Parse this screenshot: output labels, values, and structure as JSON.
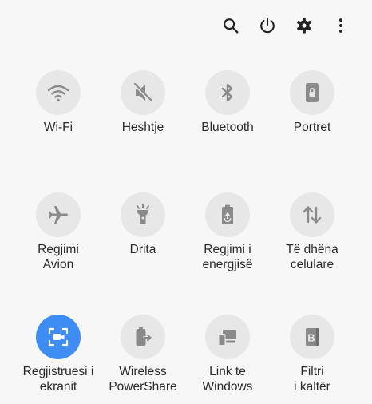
{
  "toolbar": {
    "icons": [
      "search-icon",
      "power-icon",
      "settings-gear-icon",
      "more-options-icon"
    ]
  },
  "tiles": [
    {
      "id": "wifi",
      "label": "Wi-Fi",
      "icon": "wifi-icon",
      "active": false
    },
    {
      "id": "mute",
      "label": "Heshtje",
      "icon": "mute-icon",
      "active": false
    },
    {
      "id": "bluetooth",
      "label": "Bluetooth",
      "icon": "bluetooth-icon",
      "active": false
    },
    {
      "id": "portrait",
      "label": "Portret",
      "icon": "portrait-lock-icon",
      "active": false
    },
    {
      "id": "airplane",
      "label": "Regjimi\nAvion",
      "icon": "airplane-icon",
      "active": false
    },
    {
      "id": "flashlight",
      "label": "Drita",
      "icon": "flashlight-icon",
      "active": false
    },
    {
      "id": "power-saving",
      "label": "Regjimi i\nenergjisë",
      "icon": "battery-saver-icon",
      "active": false
    },
    {
      "id": "mobile-data",
      "label": "Të dhëna\ncelulare",
      "icon": "mobile-data-icon",
      "active": false
    },
    {
      "id": "screen-recorder",
      "label": "Regjistruesi i\nekranit",
      "icon": "screen-recorder-icon",
      "active": true
    },
    {
      "id": "wireless-powershare",
      "label": "Wireless\nPowerShare",
      "icon": "wireless-powershare-icon",
      "active": false
    },
    {
      "id": "link-to-windows",
      "label": "Link te\nWindows",
      "icon": "link-to-windows-icon",
      "active": false
    },
    {
      "id": "blue-light-filter",
      "label": "Filtri\ni kaltër",
      "icon": "blue-light-filter-icon",
      "active": false
    }
  ],
  "colors": {
    "accent": "#3e8df5",
    "tile_bg": "#e7e7e7",
    "icon_gray": "#8a8a8a",
    "text": "#2a2a2a"
  }
}
